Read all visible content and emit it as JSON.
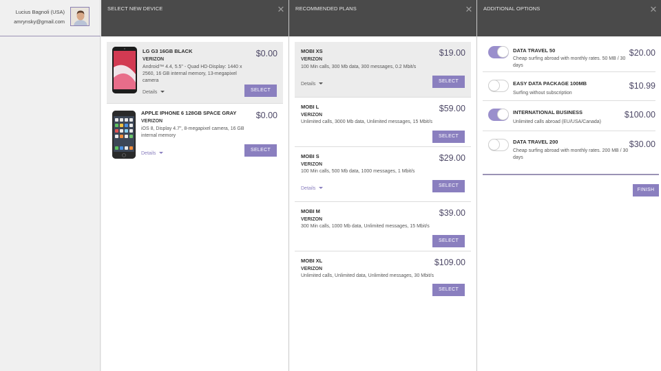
{
  "user": {
    "name": "Lucius Bagnoli (USA)",
    "email": "amrynsky@gmail.com"
  },
  "panels": {
    "devices": {
      "title": "SELECT NEW DEVICE",
      "items": [
        {
          "name": "LG G3 16GB BLACK",
          "carrier": "VERIZON",
          "desc": "Android™ 4.4, 5.5\" - Quad HD-Display: 1440 x 2560, 16 GB internal memory, 13-megapixel camera",
          "price": "$0.00",
          "details": "Details",
          "button": "SELECT"
        },
        {
          "name": "APPLE IPHONE 6 128GB SPACE GRAY",
          "carrier": "VERIZON",
          "desc": "iOS 8, Display 4.7\", 8-megapixel camera, 16 GB internal memory",
          "price": "$0.00",
          "details": "Details",
          "button": "SELECT"
        }
      ]
    },
    "plans": {
      "title": "RECOMMENDED PLANS",
      "items": [
        {
          "name": "MOBI XS",
          "carrier": "VERIZON",
          "desc": "100 Min calls, 300 Mb data, 300 messages, 0.2 Mbit/s",
          "price": "$19.00",
          "details": "Details",
          "button": "SELECT"
        },
        {
          "name": "MOBI L",
          "carrier": "VERIZON",
          "desc": "Unlimited calls, 3000 Mb data, Unlimited messages, 15 Mbit/s",
          "price": "$59.00",
          "button": "SELECT"
        },
        {
          "name": "MOBI S",
          "carrier": "VERIZON",
          "desc": "100 Min calls, 500 Mb data, 1000 messages, 1 Mbit/s",
          "price": "$29.00",
          "details": "Details",
          "button": "SELECT"
        },
        {
          "name": "MOBI M",
          "carrier": "VERIZON",
          "desc": "300 Min calls, 1000 Mb data, Unlimited messages, 15 Mbit/s",
          "price": "$39.00",
          "button": "SELECT"
        },
        {
          "name": "MOBI XL",
          "carrier": "VERIZON",
          "desc": "Unlimited calls, Unlimited data, Unlimited messages, 30 Mbit/s",
          "price": "$109.00",
          "button": "SELECT"
        }
      ]
    },
    "options": {
      "title": "ADDITIONAL OPTIONS",
      "items": [
        {
          "name": "DATA TRAVEL 50",
          "desc": "Cheap surfing abroad with monthly rates. 50 MB / 30 days",
          "price": "$20.00",
          "enabled": true
        },
        {
          "name": "EASY DATA PACKAGE 100MB",
          "desc": "Surfing without subscription",
          "price": "$10.99",
          "enabled": false
        },
        {
          "name": "INTERNATIONAL BUSINESS",
          "desc": "Unlimited calls abroad (EU/USA/Canada)",
          "price": "$100.00",
          "enabled": true
        },
        {
          "name": "DATA TRAVEL 200",
          "desc": "Cheap surfing abroad with monthly rates. 200 MB / 30 days",
          "price": "$30.00",
          "enabled": false
        }
      ],
      "finish": "FINISH"
    }
  },
  "close_glyph": "✕",
  "colors": {
    "accent": "#8a7fbf",
    "header_bg": "#4a4a4a",
    "price": "#4d4866"
  }
}
